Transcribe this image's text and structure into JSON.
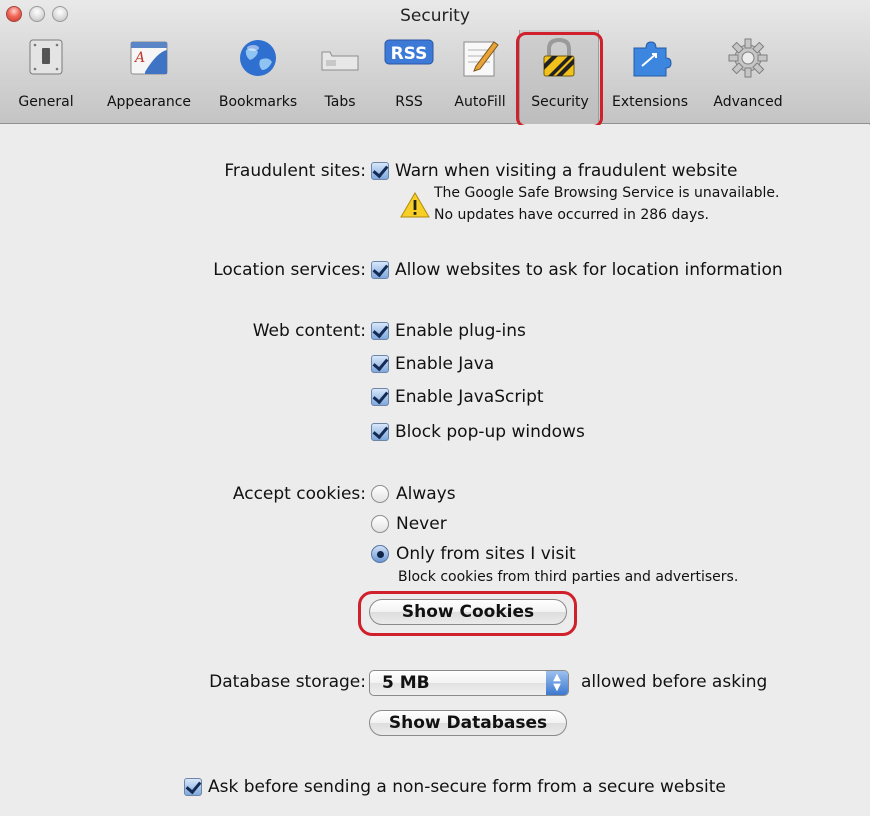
{
  "window": {
    "title": "Security",
    "traffic_lights": [
      "close",
      "minimize",
      "zoom"
    ]
  },
  "toolbar": {
    "items": [
      {
        "label": "General",
        "icon": "general-switch-icon"
      },
      {
        "label": "Appearance",
        "icon": "appearance-icon"
      },
      {
        "label": "Bookmarks",
        "icon": "globe-icon"
      },
      {
        "label": "Tabs",
        "icon": "tabs-icon"
      },
      {
        "label": "RSS",
        "icon": "rss-icon"
      },
      {
        "label": "AutoFill",
        "icon": "autofill-pencil-icon"
      },
      {
        "label": "Security",
        "icon": "lock-icon"
      },
      {
        "label": "Extensions",
        "icon": "extensions-icon"
      },
      {
        "label": "Advanced",
        "icon": "gear-icon"
      }
    ],
    "selected": "Security",
    "rss_badge": "RSS"
  },
  "fraud": {
    "label": "Fraudulent sites:",
    "checkbox_label": "Warn when visiting a fraudulent website",
    "checked": true,
    "warning_line1": "The Google Safe Browsing Service is unavailable.",
    "warning_line2": "No updates have occurred in 286 days.",
    "warning_icon": "warning-triangle-icon"
  },
  "location": {
    "label": "Location services:",
    "checkbox_label": "Allow websites to ask for location information",
    "checked": true
  },
  "web_content": {
    "label": "Web content:",
    "options": [
      {
        "label": "Enable plug-ins",
        "checked": true
      },
      {
        "label": "Enable Java",
        "checked": true
      },
      {
        "label": "Enable JavaScript",
        "checked": true
      },
      {
        "label": "Block pop-up windows",
        "checked": true
      }
    ]
  },
  "cookies": {
    "label": "Accept cookies:",
    "options": [
      {
        "label": "Always",
        "selected": false
      },
      {
        "label": "Never",
        "selected": false
      },
      {
        "label": "Only from sites I visit",
        "selected": true
      }
    ],
    "note": "Block cookies from third parties and advertisers.",
    "show_button": "Show Cookies"
  },
  "database": {
    "label": "Database storage:",
    "value": "5 MB",
    "suffix": "allowed before asking",
    "show_button": "Show Databases"
  },
  "secure_form": {
    "checkbox_label": "Ask before sending a non-secure form from a secure website",
    "checked": true
  },
  "colors": {
    "highlight": "#d0202b",
    "background": "#ececec"
  }
}
